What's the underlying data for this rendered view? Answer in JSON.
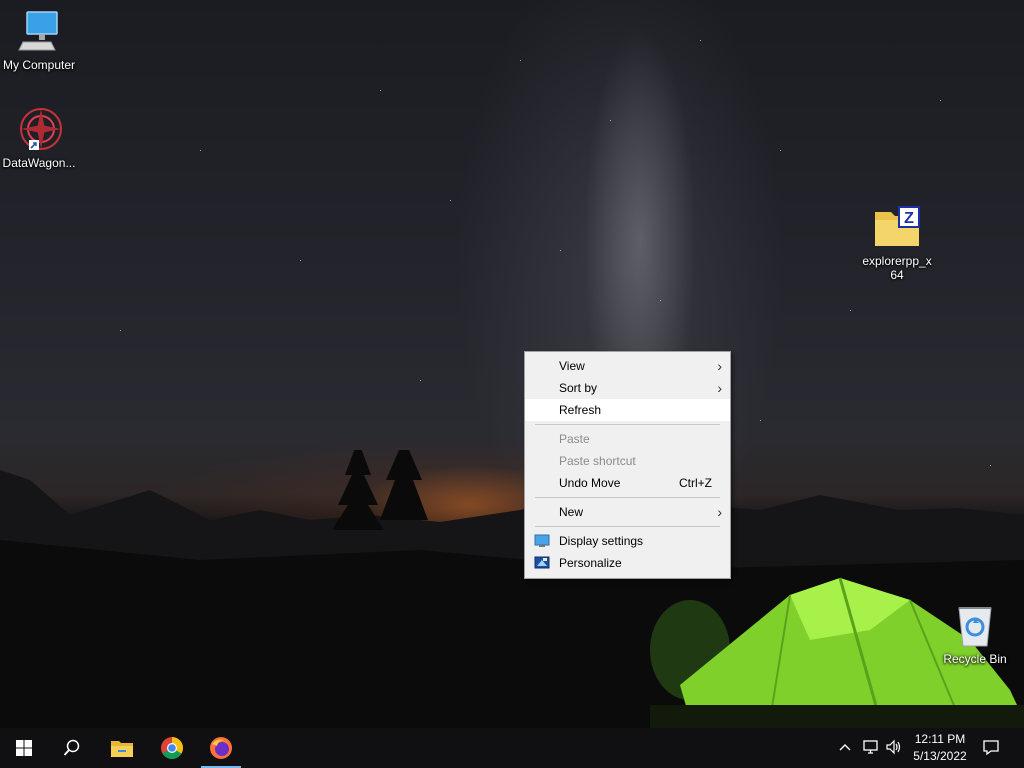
{
  "desktop": {
    "icons": [
      {
        "label": "My Computer"
      },
      {
        "label": "DataWagon..."
      },
      {
        "label": "explorerpp_x64"
      },
      {
        "label": "Recycle Bin"
      }
    ]
  },
  "context_menu": {
    "items": [
      {
        "label": "View",
        "submenu": true
      },
      {
        "label": "Sort by",
        "submenu": true
      },
      {
        "label": "Refresh",
        "highlighted": true
      },
      {
        "label": "Paste",
        "disabled": true
      },
      {
        "label": "Paste shortcut",
        "disabled": true
      },
      {
        "label": "Undo Move",
        "shortcut": "Ctrl+Z"
      },
      {
        "label": "New",
        "submenu": true
      },
      {
        "label": "Display settings",
        "icon": "display-settings-icon"
      },
      {
        "label": "Personalize",
        "icon": "personalize-icon"
      }
    ]
  },
  "taskbar": {
    "start": "windows-start-icon",
    "search": "search-icon",
    "pinned": [
      "file-explorer-icon",
      "chrome-icon",
      "firefox-icon"
    ],
    "active_app": "firefox-icon",
    "tray": [
      "chevron-up-icon",
      "network-icon",
      "volume-icon"
    ],
    "clock": {
      "time": "12:11 PM",
      "date": "5/13/2022"
    },
    "notifications": "action-center-icon"
  },
  "colors": {
    "menu_bg": "#f0f0f0",
    "menu_hover": "#ffffff",
    "taskbar_bg": "#101012",
    "accent": "#76b9ed",
    "tent": "#8ee02a"
  }
}
